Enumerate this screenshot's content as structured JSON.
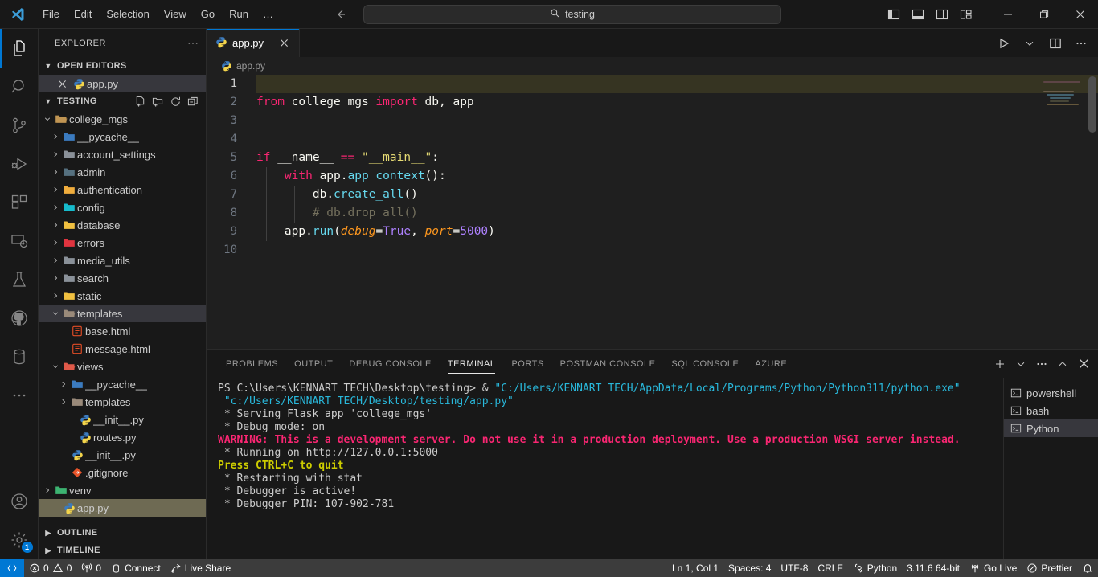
{
  "titlebar": {
    "logo": "vscode-logo",
    "menu": [
      "File",
      "Edit",
      "Selection",
      "View",
      "Go",
      "Run",
      "…"
    ],
    "back_icon": "arrow-left-icon",
    "forward_icon": "arrow-right-icon",
    "search_value": "testing",
    "search_icon": "search-icon",
    "layout_icons": [
      "toggle-primary-sidebar-icon",
      "toggle-panel-icon",
      "toggle-secondary-sidebar-icon",
      "customize-layout-icon"
    ],
    "minimize": "minimize-icon",
    "maximize": "maximize-icon",
    "close": "close-icon"
  },
  "activitybar": {
    "items": [
      {
        "name": "explorer",
        "icon": "files-icon",
        "active": true
      },
      {
        "name": "search",
        "icon": "search-icon",
        "active": false
      },
      {
        "name": "source-control",
        "icon": "source-control-icon",
        "active": false
      },
      {
        "name": "run-and-debug",
        "icon": "debug-icon",
        "active": false
      },
      {
        "name": "extensions",
        "icon": "extensions-icon",
        "active": false
      },
      {
        "name": "remote-explorer",
        "icon": "remote-icon",
        "active": false
      },
      {
        "name": "testing",
        "icon": "beaker-icon",
        "active": false
      },
      {
        "name": "github",
        "icon": "github-icon",
        "active": false
      },
      {
        "name": "database",
        "icon": "database-icon",
        "active": false
      },
      {
        "name": "more",
        "icon": "ellipsis-icon",
        "active": false
      }
    ],
    "account": {
      "icon": "account-icon"
    },
    "settings": {
      "icon": "gear-icon",
      "badge": "1"
    }
  },
  "sidebar": {
    "title": "EXPLORER",
    "more_icon": "ellipsis-icon",
    "open_editors": {
      "label": "OPEN EDITORS",
      "expanded": true,
      "items": [
        {
          "label": "app.py",
          "icon": "python-file-icon",
          "close": "close-icon",
          "selected": true
        }
      ]
    },
    "workspace": {
      "label": "TESTING",
      "expanded": true,
      "actions": [
        "new-file-icon",
        "new-folder-icon",
        "refresh-icon",
        "collapse-all-icon"
      ],
      "tree": [
        {
          "label": "college_mgs",
          "type": "folder",
          "indent": 1,
          "expanded": true,
          "icon": "folder-open-icon",
          "color": "#c09553"
        },
        {
          "label": "__pycache__",
          "type": "folder",
          "indent": 2,
          "expanded": false,
          "icon": "folder-python-icon",
          "color": "#3b7bbf"
        },
        {
          "label": "account_settings",
          "type": "folder",
          "indent": 2,
          "expanded": false,
          "icon": "folder-icon",
          "color": "#8a9199"
        },
        {
          "label": "admin",
          "type": "folder",
          "indent": 2,
          "expanded": false,
          "icon": "folder-admin-icon",
          "color": "#55707f"
        },
        {
          "label": "authentication",
          "type": "folder",
          "indent": 2,
          "expanded": false,
          "icon": "folder-auth-icon",
          "color": "#f0ad3d"
        },
        {
          "label": "config",
          "type": "folder",
          "indent": 2,
          "expanded": false,
          "icon": "folder-config-icon",
          "color": "#16bbcc"
        },
        {
          "label": "database",
          "type": "folder",
          "indent": 2,
          "expanded": false,
          "icon": "folder-database-icon",
          "color": "#f0c040"
        },
        {
          "label": "errors",
          "type": "folder",
          "indent": 2,
          "expanded": false,
          "icon": "folder-error-icon",
          "color": "#e0343f"
        },
        {
          "label": "media_utils",
          "type": "folder",
          "indent": 2,
          "expanded": false,
          "icon": "folder-icon",
          "color": "#8a9199"
        },
        {
          "label": "search",
          "type": "folder",
          "indent": 2,
          "expanded": false,
          "icon": "folder-icon",
          "color": "#8a9199"
        },
        {
          "label": "static",
          "type": "folder",
          "indent": 2,
          "expanded": false,
          "icon": "folder-static-icon",
          "color": "#f0c040"
        },
        {
          "label": "templates",
          "type": "folder",
          "indent": 2,
          "expanded": true,
          "icon": "folder-template-icon",
          "color": "#9a8a7a",
          "selected": true
        },
        {
          "label": "base.html",
          "type": "file",
          "indent": 3,
          "icon": "html-file-icon",
          "color": "#e44d26"
        },
        {
          "label": "message.html",
          "type": "file",
          "indent": 3,
          "icon": "html-file-icon",
          "color": "#e44d26"
        },
        {
          "label": "views",
          "type": "folder",
          "indent": 2,
          "expanded": true,
          "icon": "folder-views-icon",
          "color": "#e05a4a"
        },
        {
          "label": "__pycache__",
          "type": "folder",
          "indent": 3,
          "expanded": false,
          "icon": "folder-python-icon",
          "color": "#3b7bbf"
        },
        {
          "label": "templates",
          "type": "folder",
          "indent": 3,
          "expanded": false,
          "icon": "folder-template-icon",
          "color": "#9a8a7a"
        },
        {
          "label": "__init__.py",
          "type": "file",
          "indent": 4,
          "icon": "python-file-icon",
          "color": "#3b7bbf"
        },
        {
          "label": "routes.py",
          "type": "file",
          "indent": 4,
          "icon": "python-file-icon",
          "color": "#3b7bbf"
        },
        {
          "label": "__init__.py",
          "type": "file",
          "indent": 3,
          "icon": "python-file-icon",
          "color": "#3b7bbf"
        },
        {
          "label": ".gitignore",
          "type": "file",
          "indent": 3,
          "icon": "git-file-icon",
          "color": "#e8542a"
        },
        {
          "label": "venv",
          "type": "folder",
          "indent": 1,
          "expanded": false,
          "icon": "folder-venv-icon",
          "color": "#3cb371"
        },
        {
          "label": "app.py",
          "type": "file",
          "indent": 2,
          "icon": "python-file-icon",
          "color": "#3b7bbf",
          "sel_gold": true
        }
      ]
    },
    "outline": {
      "label": "OUTLINE",
      "expanded": false
    },
    "timeline": {
      "label": "TIMELINE",
      "expanded": false
    }
  },
  "editor": {
    "tab": {
      "label": "app.py",
      "icon": "python-file-icon",
      "close": "close-icon",
      "active": true
    },
    "toolbar": [
      "run-python-icon",
      "chevron-down-icon",
      "split-editor-icon",
      "more-actions-icon"
    ],
    "breadcrumb": {
      "icon": "python-file-icon",
      "label": "app.py"
    },
    "line_count": 10,
    "cursor_line": 1,
    "lines": [
      {
        "n": 1,
        "tokens": []
      },
      {
        "n": 2,
        "tokens": [
          {
            "t": "from",
            "c": "c-kw"
          },
          {
            "t": " ",
            "c": "c-id"
          },
          {
            "t": "college_mgs",
            "c": "c-id"
          },
          {
            "t": " ",
            "c": "c-id"
          },
          {
            "t": "import",
            "c": "c-kw"
          },
          {
            "t": " ",
            "c": "c-id"
          },
          {
            "t": "db, app",
            "c": "c-id"
          }
        ]
      },
      {
        "n": 3,
        "tokens": []
      },
      {
        "n": 4,
        "tokens": []
      },
      {
        "n": 5,
        "tokens": [
          {
            "t": "if",
            "c": "c-kw"
          },
          {
            "t": " ",
            "c": "c-id"
          },
          {
            "t": "__name__",
            "c": "c-id"
          },
          {
            "t": " ",
            "c": "c-id"
          },
          {
            "t": "==",
            "c": "c-op"
          },
          {
            "t": " ",
            "c": "c-id"
          },
          {
            "t": "\"__main__\"",
            "c": "c-str"
          },
          {
            "t": ":",
            "c": "c-id"
          }
        ]
      },
      {
        "n": 6,
        "tokens": [
          {
            "t": "    ",
            "c": "c-id"
          },
          {
            "t": "with",
            "c": "c-kw"
          },
          {
            "t": " ",
            "c": "c-id"
          },
          {
            "t": "app",
            "c": "c-id"
          },
          {
            "t": ".",
            "c": "c-id"
          },
          {
            "t": "app_context",
            "c": "c-fn"
          },
          {
            "t": "():",
            "c": "c-id"
          }
        ]
      },
      {
        "n": 7,
        "tokens": [
          {
            "t": "        ",
            "c": "c-id"
          },
          {
            "t": "db",
            "c": "c-id"
          },
          {
            "t": ".",
            "c": "c-id"
          },
          {
            "t": "create_all",
            "c": "c-fn"
          },
          {
            "t": "()",
            "c": "c-id"
          }
        ]
      },
      {
        "n": 8,
        "tokens": [
          {
            "t": "        ",
            "c": "c-id"
          },
          {
            "t": "# db.drop_all()",
            "c": "c-cmt"
          }
        ]
      },
      {
        "n": 9,
        "tokens": [
          {
            "t": "    ",
            "c": "c-id"
          },
          {
            "t": "app",
            "c": "c-id"
          },
          {
            "t": ".",
            "c": "c-id"
          },
          {
            "t": "run",
            "c": "c-fn"
          },
          {
            "t": "(",
            "c": "c-id"
          },
          {
            "t": "debug",
            "c": "c-param"
          },
          {
            "t": "=",
            "c": "c-id"
          },
          {
            "t": "True",
            "c": "c-num"
          },
          {
            "t": ", ",
            "c": "c-id"
          },
          {
            "t": "port",
            "c": "c-param"
          },
          {
            "t": "=",
            "c": "c-id"
          },
          {
            "t": "5000",
            "c": "c-num"
          },
          {
            "t": ")",
            "c": "c-id"
          }
        ]
      },
      {
        "n": 10,
        "tokens": []
      }
    ]
  },
  "panel": {
    "tabs": [
      {
        "label": "PROBLEMS",
        "active": false
      },
      {
        "label": "OUTPUT",
        "active": false
      },
      {
        "label": "DEBUG CONSOLE",
        "active": false
      },
      {
        "label": "TERMINAL",
        "active": true
      },
      {
        "label": "PORTS",
        "active": false
      },
      {
        "label": "POSTMAN CONSOLE",
        "active": false
      },
      {
        "label": "SQL CONSOLE",
        "active": false
      },
      {
        "label": "AZURE",
        "active": false
      }
    ],
    "actions": [
      "new-terminal-icon",
      "chevron-down-icon",
      "more-actions-icon",
      "maximize-panel-icon",
      "close-panel-icon"
    ],
    "terminal_lines": [
      [
        {
          "t": "PS C:\\Users\\KENNART TECH\\Desktop\\testing> & ",
          "c": "t-white"
        },
        {
          "t": "\"C:/Users/KENNART TECH/AppData/Local/Programs/Python/Python311/python.exe\"",
          "c": "t-cyan"
        }
      ],
      [
        {
          "t": " ",
          "c": "t-white"
        },
        {
          "t": "\"c:/Users/KENNART TECH/Desktop/testing/app.py\"",
          "c": "t-cyan"
        }
      ],
      [
        {
          "t": " * Serving Flask app 'college_mgs'",
          "c": "t-white"
        }
      ],
      [
        {
          "t": " * Debug mode: on",
          "c": "t-white"
        }
      ],
      [
        {
          "t": "WARNING: This is a development server. Do not use it in a production deployment. Use a production WSGI server instead.",
          "c": "t-pink"
        }
      ],
      [
        {
          "t": " * Running on http://127.0.0.1:5000",
          "c": "t-white"
        }
      ],
      [
        {
          "t": "Press CTRL+C to quit",
          "c": "t-yellow"
        }
      ],
      [
        {
          "t": " * Restarting with stat",
          "c": "t-white"
        }
      ],
      [
        {
          "t": " * Debugger is active!",
          "c": "t-white"
        }
      ],
      [
        {
          "t": " * Debugger PIN: 107-902-781",
          "c": "t-white"
        }
      ]
    ],
    "terminal_list": [
      {
        "label": "powershell",
        "icon": "terminal-icon",
        "active": false
      },
      {
        "label": "bash",
        "icon": "terminal-icon",
        "active": false
      },
      {
        "label": "Python",
        "icon": "terminal-icon",
        "active": true
      }
    ]
  },
  "statusbar": {
    "remote_icon": "remote-indicator-icon",
    "left": [
      {
        "name": "errors-warnings",
        "icon": "error-icon",
        "label": "0",
        "icon2": "warning-icon",
        "label2": "0"
      },
      {
        "name": "ports",
        "icon": "radio-tower-icon",
        "label": "0"
      },
      {
        "name": "connect",
        "icon": "database-icon",
        "label": "Connect"
      },
      {
        "name": "live-share",
        "icon": "live-share-icon",
        "label": "Live Share"
      }
    ],
    "right": [
      {
        "name": "cursor-position",
        "label": "Ln 1, Col 1"
      },
      {
        "name": "indentation",
        "label": "Spaces: 4"
      },
      {
        "name": "encoding",
        "label": "UTF-8"
      },
      {
        "name": "eol",
        "label": "CRLF"
      },
      {
        "name": "language-mode",
        "label": "Python",
        "icon": "python-status-icon"
      },
      {
        "name": "python-interpreter",
        "label": "3.11.6 64-bit"
      },
      {
        "name": "go-live",
        "label": "Go Live",
        "icon": "broadcast-icon"
      },
      {
        "name": "prettier",
        "label": "Prettier",
        "icon": "prettier-check-icon"
      },
      {
        "name": "notifications",
        "label": "",
        "icon": "bell-icon"
      }
    ]
  },
  "colors": {
    "accent": "#0078d4",
    "titlebar_bg": "#181818",
    "editor_bg": "#1f1f1f",
    "statusbar_bg": "#3c3c3c",
    "selection_gold": "#6e6a53"
  }
}
